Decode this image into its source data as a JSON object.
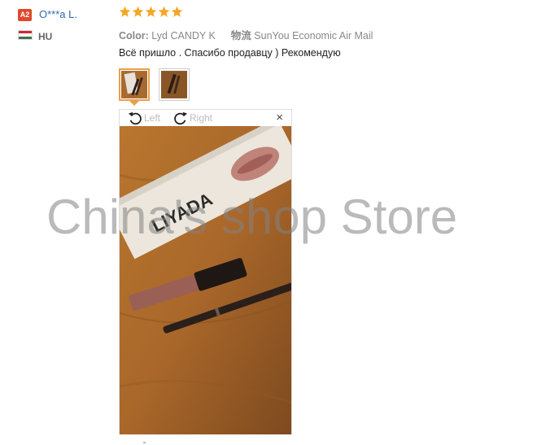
{
  "reviewer": {
    "badge": "A2",
    "name": "O***a L.",
    "country": "HU"
  },
  "review": {
    "rating": 5,
    "color_label": "Color:",
    "color_value": "Lyd CANDY K",
    "shipping_label": "物流",
    "shipping_value": "SunYou Economic Air Mail",
    "feedback": "Всё пришло . Спасибо продавцу ) Рекомендую"
  },
  "viewer": {
    "rotate_left": "Left",
    "rotate_right": "Right",
    "close": "×"
  },
  "watermark": "China's shop Store",
  "photo_text": {
    "brand": "LIYADA"
  },
  "colors": {
    "star": "#f5a623",
    "link": "#2d6bb3",
    "badge": "#e0482b",
    "active_thumb": "#e8a04a"
  }
}
